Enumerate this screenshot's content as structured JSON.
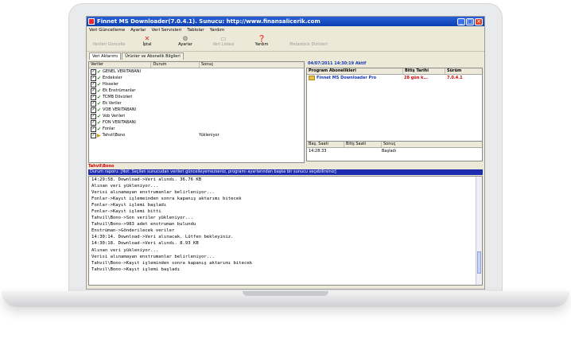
{
  "window": {
    "title": "Finnet MS Downloader(7.0.4.1). Sunucu: http://www.finansalicerik.com"
  },
  "menu": [
    "Veri Güncelleme",
    "Ayarlar",
    "Veri Servisleri",
    "Tablolar",
    "Yardım"
  ],
  "toolbar": {
    "update": "Verileri Güncelle",
    "cancel": "İptal",
    "settings": "Ayarlar",
    "data_list": "Veri Listesi",
    "help": "Yardım",
    "metastock": "Metastock Dizinleri"
  },
  "tabs": [
    "Veri Aktarımı",
    "Ürünler ve Abonelik Bilgileri"
  ],
  "table": {
    "headers": [
      "Veriler",
      "Durum",
      "Sonuç"
    ],
    "rows": [
      {
        "name": "GENEL VERITABANI",
        "status": "",
        "result": ""
      },
      {
        "name": "Endeksler",
        "status": "",
        "result": ""
      },
      {
        "name": "Hisseler",
        "status": "",
        "result": ""
      },
      {
        "name": "Ek Enstrümanlar",
        "status": "",
        "result": ""
      },
      {
        "name": "TCMB Dövizleri",
        "status": "",
        "result": ""
      },
      {
        "name": "Ek Veriler",
        "status": "",
        "result": ""
      },
      {
        "name": "VOB VERITABANI",
        "status": "",
        "result": ""
      },
      {
        "name": "Vob Verileri",
        "status": "",
        "result": ""
      },
      {
        "name": "FON VERITABANI",
        "status": "",
        "result": ""
      },
      {
        "name": "Fonlar",
        "status": "",
        "result": ""
      },
      {
        "name": "Tahvil\\Bono",
        "status": "",
        "result": "Yükleniyor"
      }
    ]
  },
  "right": {
    "date": "04/07/2011 14:30:19 Aktif",
    "subs_headers": [
      "Program Abonelikleri",
      "Bitiş Tarihi",
      "Sürüm"
    ],
    "subs_row": {
      "name": "Finnet MS Downloader Pro",
      "end": "28 gün k...",
      "version": "7.0.4.1"
    },
    "time_headers": [
      "Baş. Saati",
      "Bitiş Saati",
      "Sonuç"
    ],
    "time_row": {
      "start": "14:28:33",
      "end": "",
      "result": "Başladı"
    }
  },
  "log": {
    "title": "Tahvil\\Bono",
    "status": "Durum raporu: [Not: Seçilen sunucudan verileri güncelleyemezseniz, programı ayarlarından başka bir sunucu seçebilirsiniz]",
    "lines": [
      "14:29:58. Download->Veri alındı. 36.76 KB",
      "Alınan veri yükleniyor...",
      "Verisi alınamayan enstrumanlar belirleniyor...",
      "Fonlar->Kayıt işlemeinden sonra kapanış aktarımı bitecek",
      "Fonlar->Kayıt işlemi başladı",
      "Fonlar->Kayıt işlemi bitti",
      "Tahvil\\Bono->Son veriler yükleniyor...",
      "Tahvil\\Bono->983 adet enstruman bulundu",
      "Enstrüman->Gönderilecek veriler",
      "14:30:14. Download->Veri alınacak. Lütfen bekleyiniz.",
      "14:30:18. Download->Veri alındı. 8.93 KB",
      "Alınan veri yükleniyor...",
      "Verisi alınamayan enstrumanlar belirleniyor...",
      "Tahvil\\Bono->Kayıt işleminden sonra kapanış aktarımı bitecek",
      "Tahvil\\Bono->Kayıt işlemi başladı"
    ]
  },
  "colors": {
    "title_bar": "#0a3fb0",
    "status_bar": "#1c2bb0",
    "accent_red": "#d20000",
    "date_blue": "#1438b7"
  }
}
